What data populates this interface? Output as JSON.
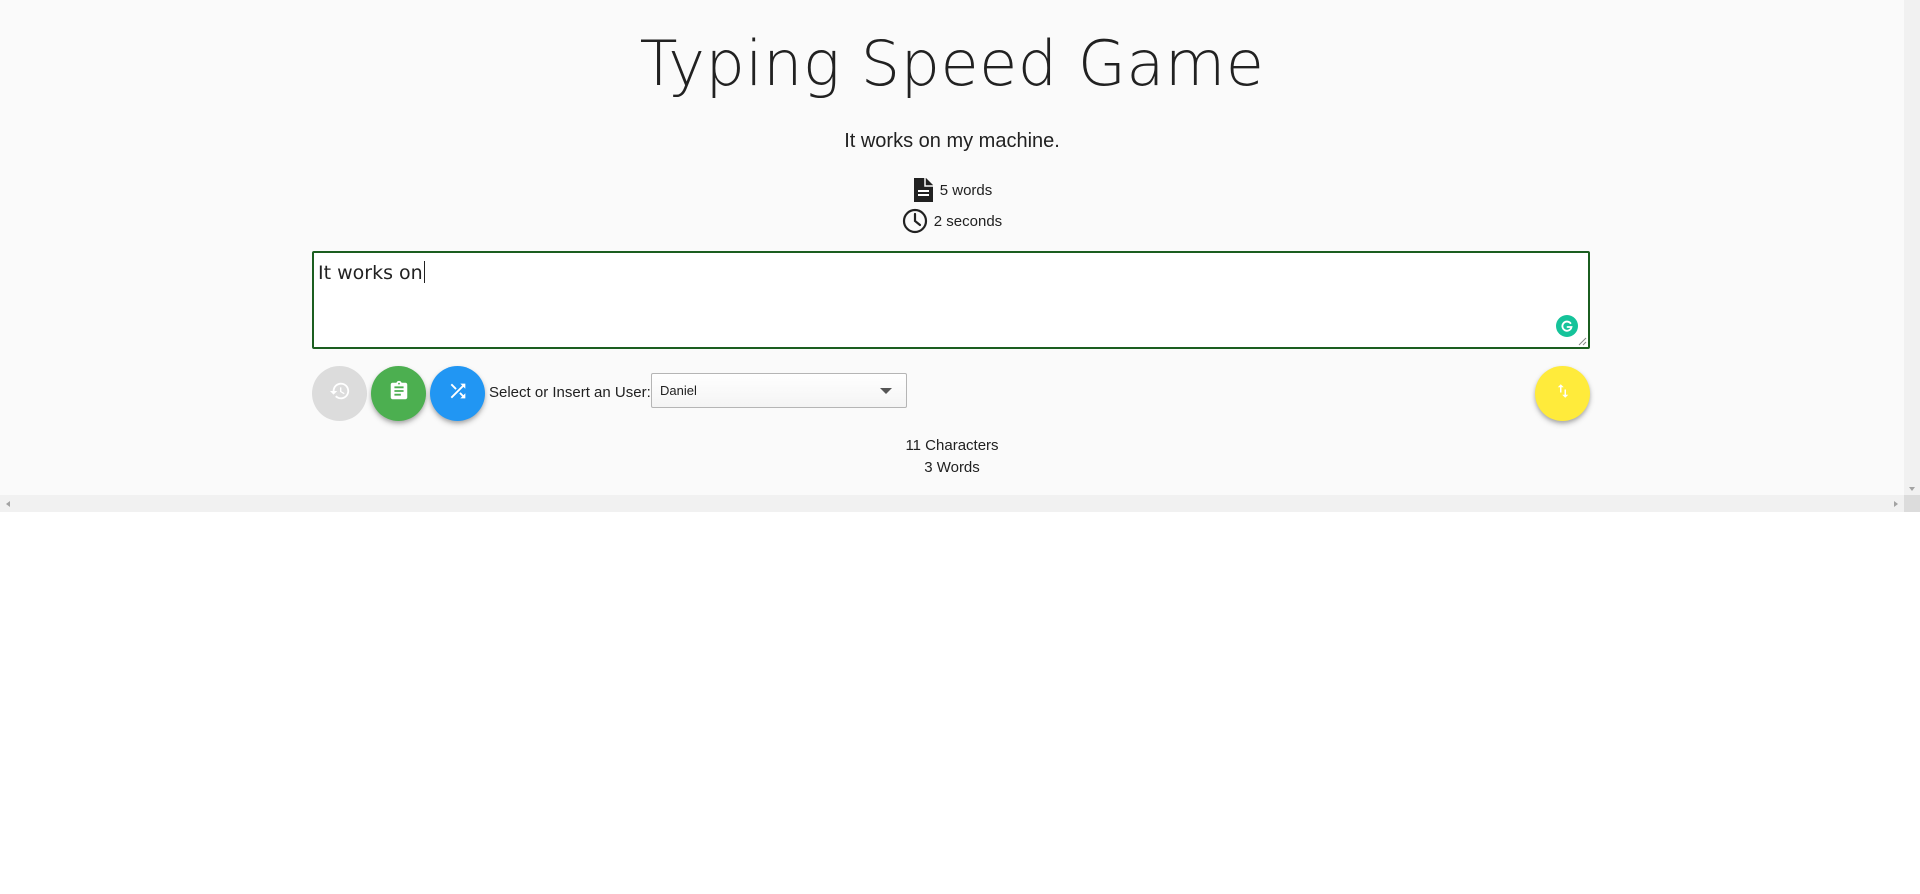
{
  "header": {
    "title": "Typing Speed Game"
  },
  "challenge": {
    "sentence": "It works on my machine.",
    "word_count_label": "5 words",
    "time_label": "2 seconds"
  },
  "input": {
    "typed_text": "It works on"
  },
  "controls": {
    "history_icon": "history-icon",
    "clipboard_icon": "clipboard-icon",
    "shuffle_icon": "shuffle-icon",
    "swap_icon": "swap-vertical-icon",
    "user_label": "Select or Insert an User:",
    "user_selected": "Daniel"
  },
  "counters": {
    "characters": "11 Characters",
    "words": "3 Words"
  },
  "colors": {
    "input_border": "#1b5e20",
    "history_button": "#dcdcdc",
    "clipboard_button": "#4caf50",
    "shuffle_button": "#2196f3",
    "swap_button": "#ffeb3b",
    "grammarly": "#15c39a"
  }
}
